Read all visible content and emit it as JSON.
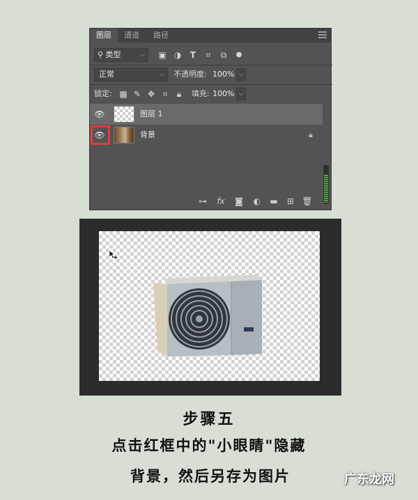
{
  "panel": {
    "tabs": [
      "图层",
      "通道",
      "路径"
    ],
    "filter": {
      "kind_label": "类型",
      "icons": [
        "image-filter-icon",
        "adjustment-filter-icon",
        "type-filter-icon",
        "shape-filter-icon",
        "smart-object-filter-icon",
        "filter-toggle-icon"
      ]
    },
    "blend_mode": "正常",
    "opacity_label": "不透明度:",
    "opacity_value": "100%",
    "lock_label": "锁定:",
    "fill_label": "填充:",
    "fill_value": "100%",
    "layers": [
      {
        "name": "图层 1",
        "selected": true,
        "visible": true
      },
      {
        "name": "背景",
        "selected": false,
        "visible": true,
        "locked": true
      }
    ],
    "bottom_icons": [
      "link-icon",
      "fx-icon",
      "mask-icon",
      "adjustment-icon",
      "folder-icon",
      "new-layer-icon",
      "trash-icon"
    ]
  },
  "caption": {
    "line1": "步骤五",
    "line2": "点击红框中的\"小眼睛\"隐藏",
    "line3": "背景，然后另存为图片"
  },
  "watermark": "广东龙网",
  "colors": {
    "panel_bg": "#535353",
    "highlight": "#e23b3b",
    "page_bg": "#d7dfd4"
  }
}
